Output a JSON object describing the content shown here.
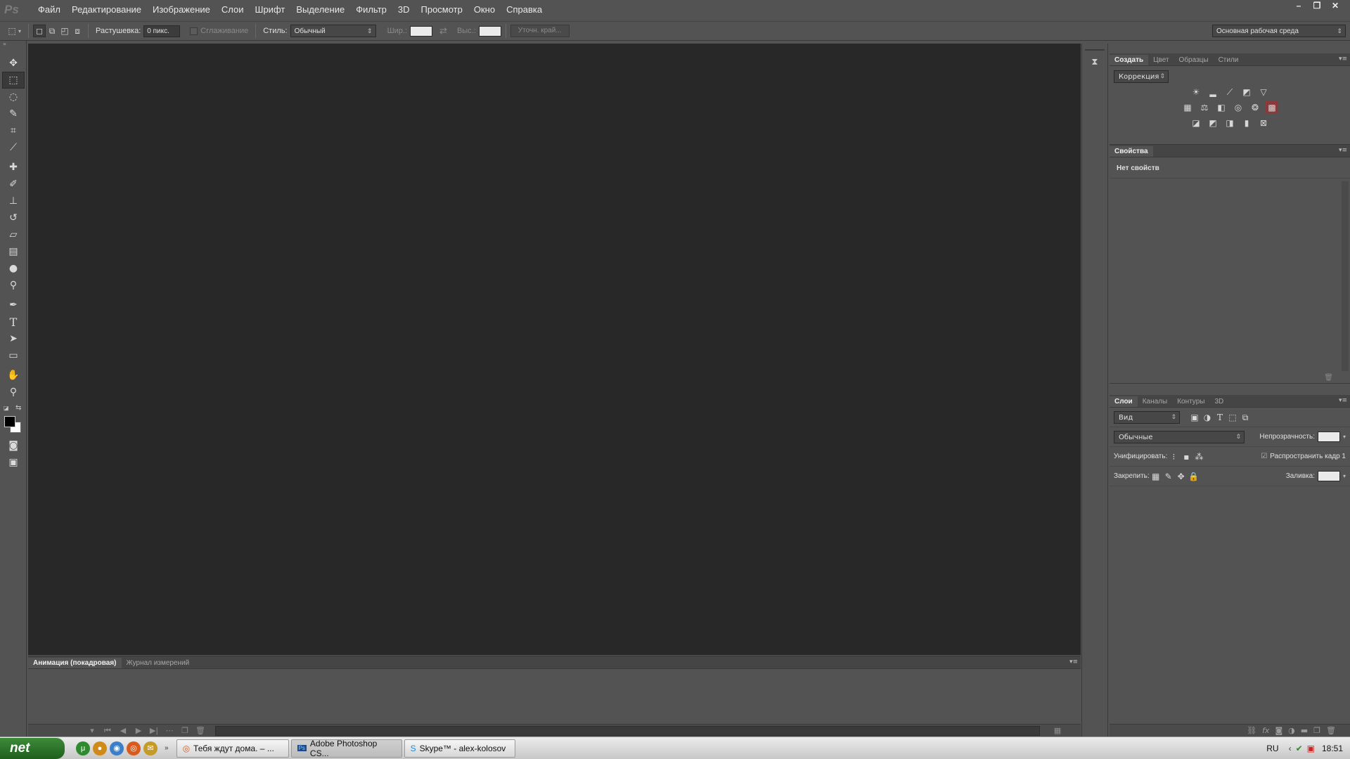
{
  "app": {
    "logo": "Ps"
  },
  "menu": [
    "Файл",
    "Редактирование",
    "Изображение",
    "Слои",
    "Шрифт",
    "Выделение",
    "Фильтр",
    "3D",
    "Просмотр",
    "Окно",
    "Справка"
  ],
  "window_controls": [
    "–",
    "❐",
    "✕"
  ],
  "options": {
    "feather_label": "Растушевка:",
    "feather_value": "0 пикс.",
    "antialias_label": "Сглаживание",
    "style_label": "Стиль:",
    "style_value": "Обычный",
    "width_label": "Шир.:",
    "height_label": "Выс.:",
    "refine_label": "Уточн. край...",
    "workspace": "Основная рабочая среда"
  },
  "tools": [
    "move",
    "marquee",
    "lasso",
    "quick-select",
    "crop",
    "eyedropper",
    "healing",
    "brush",
    "stamp",
    "history-brush",
    "eraser",
    "gradient",
    "blur",
    "dodge",
    "pen",
    "type",
    "path-select",
    "rectangle",
    "hand",
    "zoom"
  ],
  "animation_panel": {
    "tabs": [
      "Анимация (покадровая)",
      "Журнал измерений"
    ]
  },
  "adjustments_panel": {
    "tabs": [
      "Создать",
      "Цвет",
      "Образцы",
      "Стили"
    ],
    "preset": "Коррекция"
  },
  "properties_panel": {
    "tab": "Свойства",
    "empty_text": "Нет свойств"
  },
  "layers_panel": {
    "tabs": [
      "Слои",
      "Каналы",
      "Контуры",
      "3D"
    ],
    "filter": "Вид",
    "blend_mode": "Обычные",
    "opacity_label": "Непрозрачность:",
    "unify_label": "Унифицировать:",
    "propagate_label": "Распространить кадр 1",
    "lock_label": "Закрепить:",
    "fill_label": "Заливка:"
  },
  "taskbar": {
    "start": "net",
    "tasks": [
      "Тебя ждут дома. – ...",
      "Adobe Photoshop CS...",
      "Skype™ - alex-kolosov"
    ],
    "lang": "RU",
    "time": "18:51"
  }
}
